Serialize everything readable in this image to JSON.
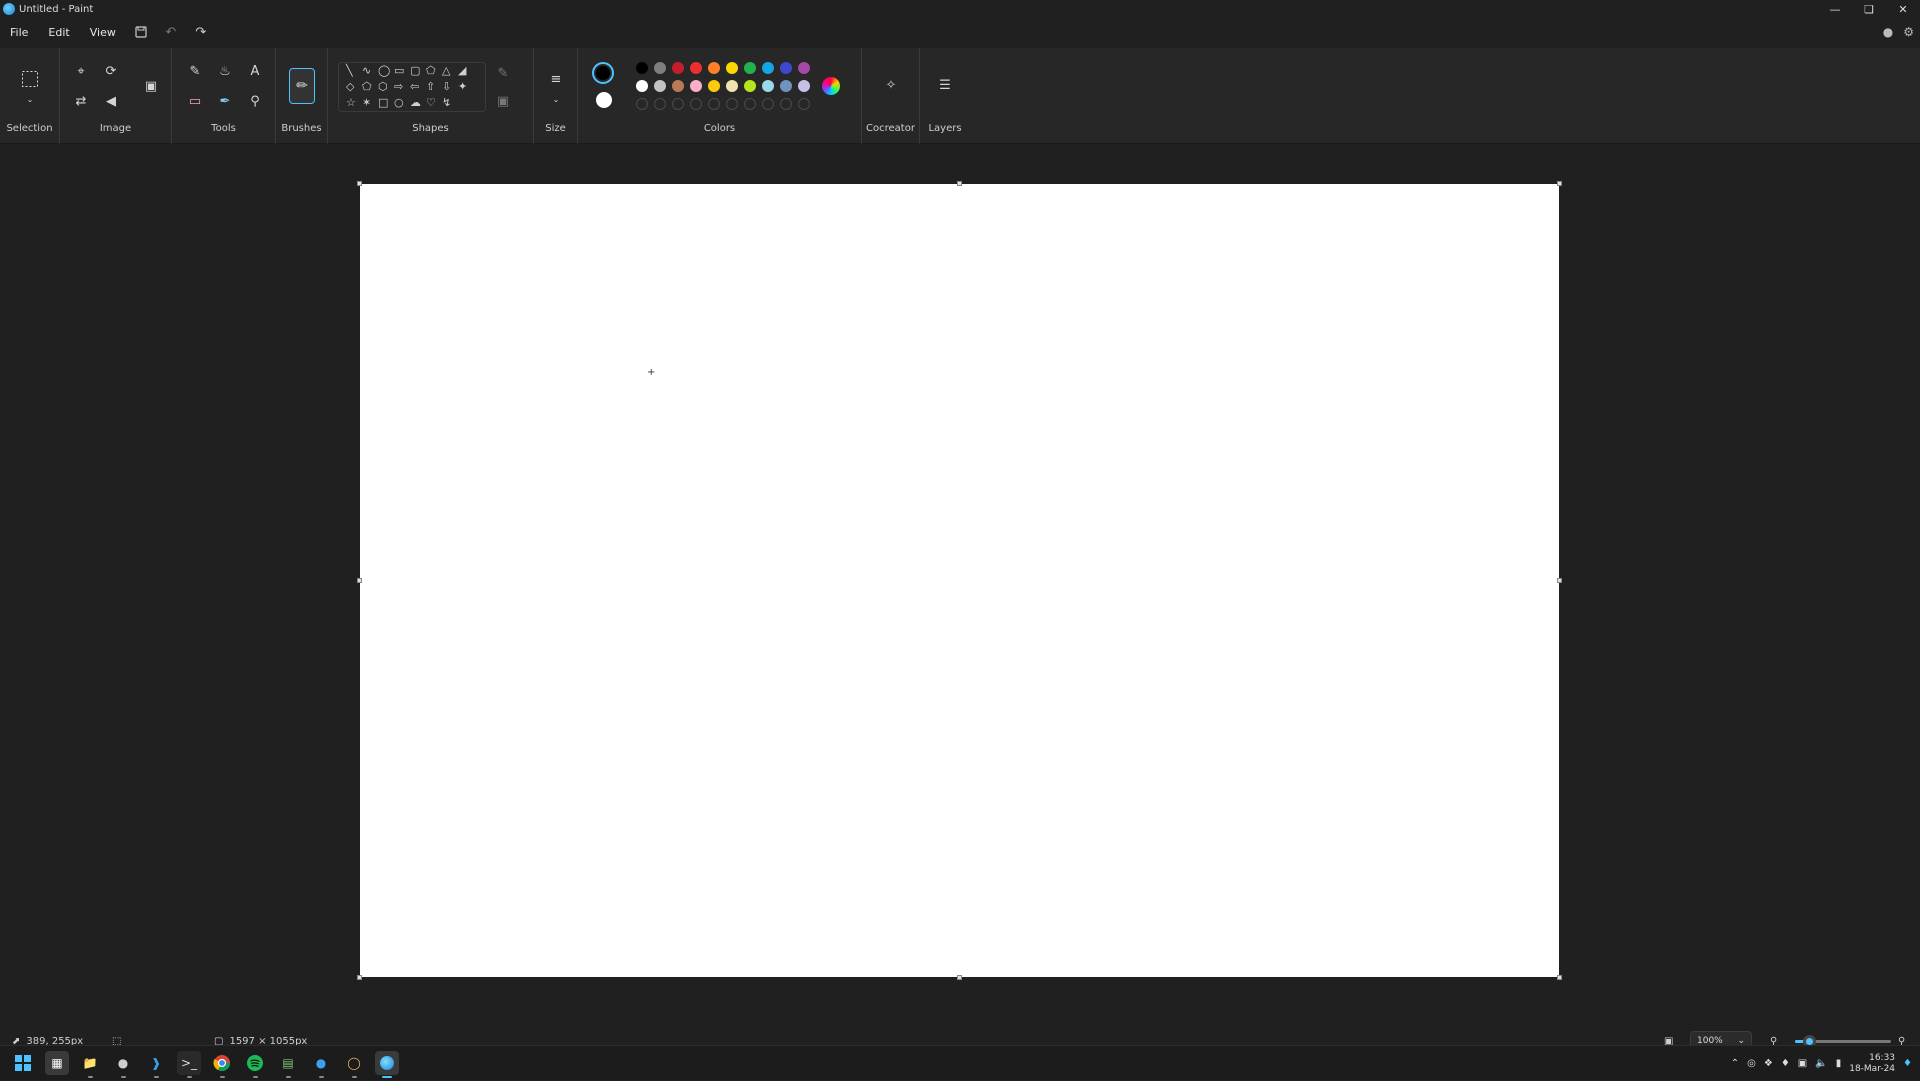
{
  "window": {
    "title": "Untitled - Paint"
  },
  "menu": {
    "file": "File",
    "edit": "Edit",
    "view": "View"
  },
  "ribbon": {
    "groups": {
      "selection": "Selection",
      "image": "Image",
      "tools": "Tools",
      "brushes": "Brushes",
      "shapes": "Shapes",
      "size": "Size",
      "colors": "Colors",
      "cocreator": "Cocreator",
      "layers": "Layers"
    },
    "colors": {
      "primary": "#000000",
      "secondary": "#ffffff",
      "row1": [
        "#000000",
        "#7f7f7f",
        "#c41e2e",
        "#ee2d2d",
        "#ff7f27",
        "#ffd700",
        "#22b14c",
        "#14a5e3",
        "#3f48cc",
        "#a349a4"
      ],
      "row2": [
        "#ffffff",
        "#c3c3c3",
        "#b97a57",
        "#ffaec9",
        "#ffc90e",
        "#efe4b0",
        "#b5e61d",
        "#99d9ea",
        "#7092be",
        "#c8bfe7"
      ]
    }
  },
  "status": {
    "cursor_pos": "389, 255px",
    "canvas_size": "1597 × 1055px",
    "zoom": "100%",
    "zoom_fraction": 0.15
  },
  "taskbar": {
    "time": "16:33",
    "date": "18-Mar-24"
  }
}
